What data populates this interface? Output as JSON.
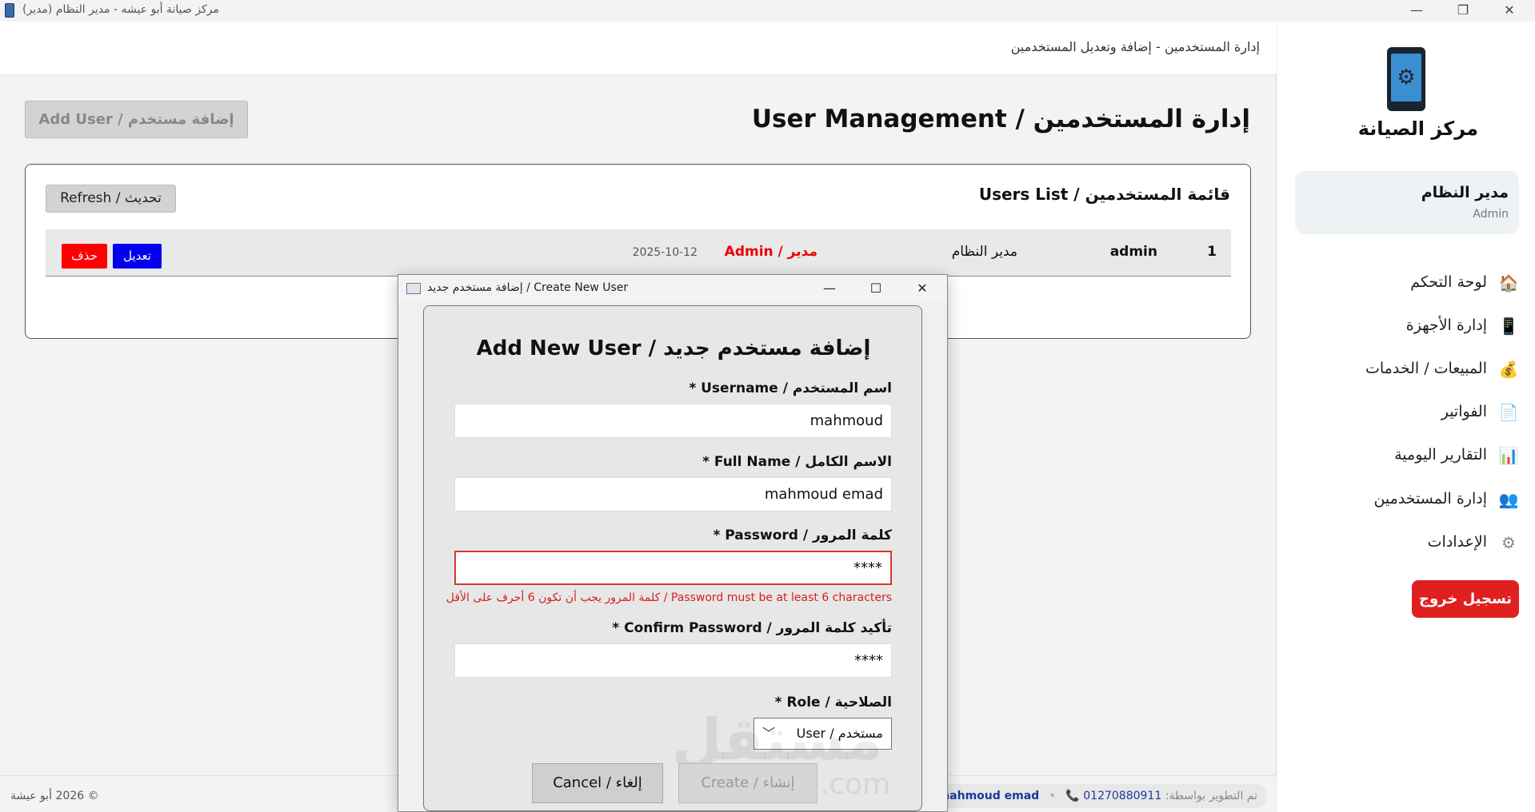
{
  "window": {
    "title": "مركز صيانة أبو عيشه - مدير النظام (مدير)",
    "minimize": "—",
    "restore": "❐",
    "close": "✕"
  },
  "header": {
    "breadcrumb": "إدارة المستخدمين - إضافة وتعديل المستخدمين"
  },
  "page": {
    "title": "إدارة المستخدمين / User Management",
    "add_user_label": "إضافة مستخدم / Add User"
  },
  "users_panel": {
    "title": "قائمة المستخدمين / Users List",
    "refresh_label": "تحديث / Refresh",
    "rows": [
      {
        "index": "1",
        "username": "admin",
        "full_name": "مدير النظام",
        "role": "مدير / Admin",
        "date": "2025-10-12",
        "edit_label": "تعديل",
        "delete_label": "حذف"
      }
    ]
  },
  "footer": {
    "copyright": "© 2026 أبو عيشة",
    "dev_label": "تم التطوير بواسطة:",
    "dev_name": "mahmoud emad",
    "dot": "•",
    "phone_icon": "📞",
    "phone": "01270880911"
  },
  "sidebar": {
    "logo_icon": "⚙",
    "brand": "مركز الصيانة",
    "user_name": "مدير النظام",
    "user_role": "Admin",
    "nav": [
      {
        "icon": "🏠",
        "label": "لوحة التحكم"
      },
      {
        "icon": "📱",
        "label": "إدارة الأجهزة"
      },
      {
        "icon": "💰",
        "label": "المبيعات / الخدمات"
      },
      {
        "icon": "📄",
        "label": "الفواتير"
      },
      {
        "icon": "📊",
        "label": "التقارير اليومية"
      },
      {
        "icon": "👥",
        "label": "إدارة المستخدمين"
      },
      {
        "icon": "⚙",
        "label": "الإعدادات"
      }
    ],
    "logout_label": "تسجيل خروج"
  },
  "dialog": {
    "title": "إضافة مستخدم جديد / Create New User",
    "minimize": "—",
    "maximize": "☐",
    "close": "✕",
    "heading": "إضافة مستخدم جديد / Add New User",
    "username_label": "اسم المستخدم / Username *",
    "username_value": "mahmoud",
    "fullname_label": "الاسم الكامل / Full Name *",
    "fullname_value": "mahmoud emad",
    "password_label": "كلمة المرور / Password *",
    "password_value": "****",
    "password_error": "كلمة المرور يجب أن تكون 6 أحرف على الأقل / Password must be at least 6 characters",
    "confirm_label": "تأكيد كلمة المرور / Confirm Password *",
    "confirm_value": "****",
    "role_label": "الصلاحية / Role *",
    "role_value": "مستخدم / User",
    "role_chevron": "﹀",
    "cancel_label": "إلغاء / Cancel",
    "create_label": "إنشاء / Create",
    "watermark": "مستقل",
    "watermark_sub": "mostaql.com"
  }
}
